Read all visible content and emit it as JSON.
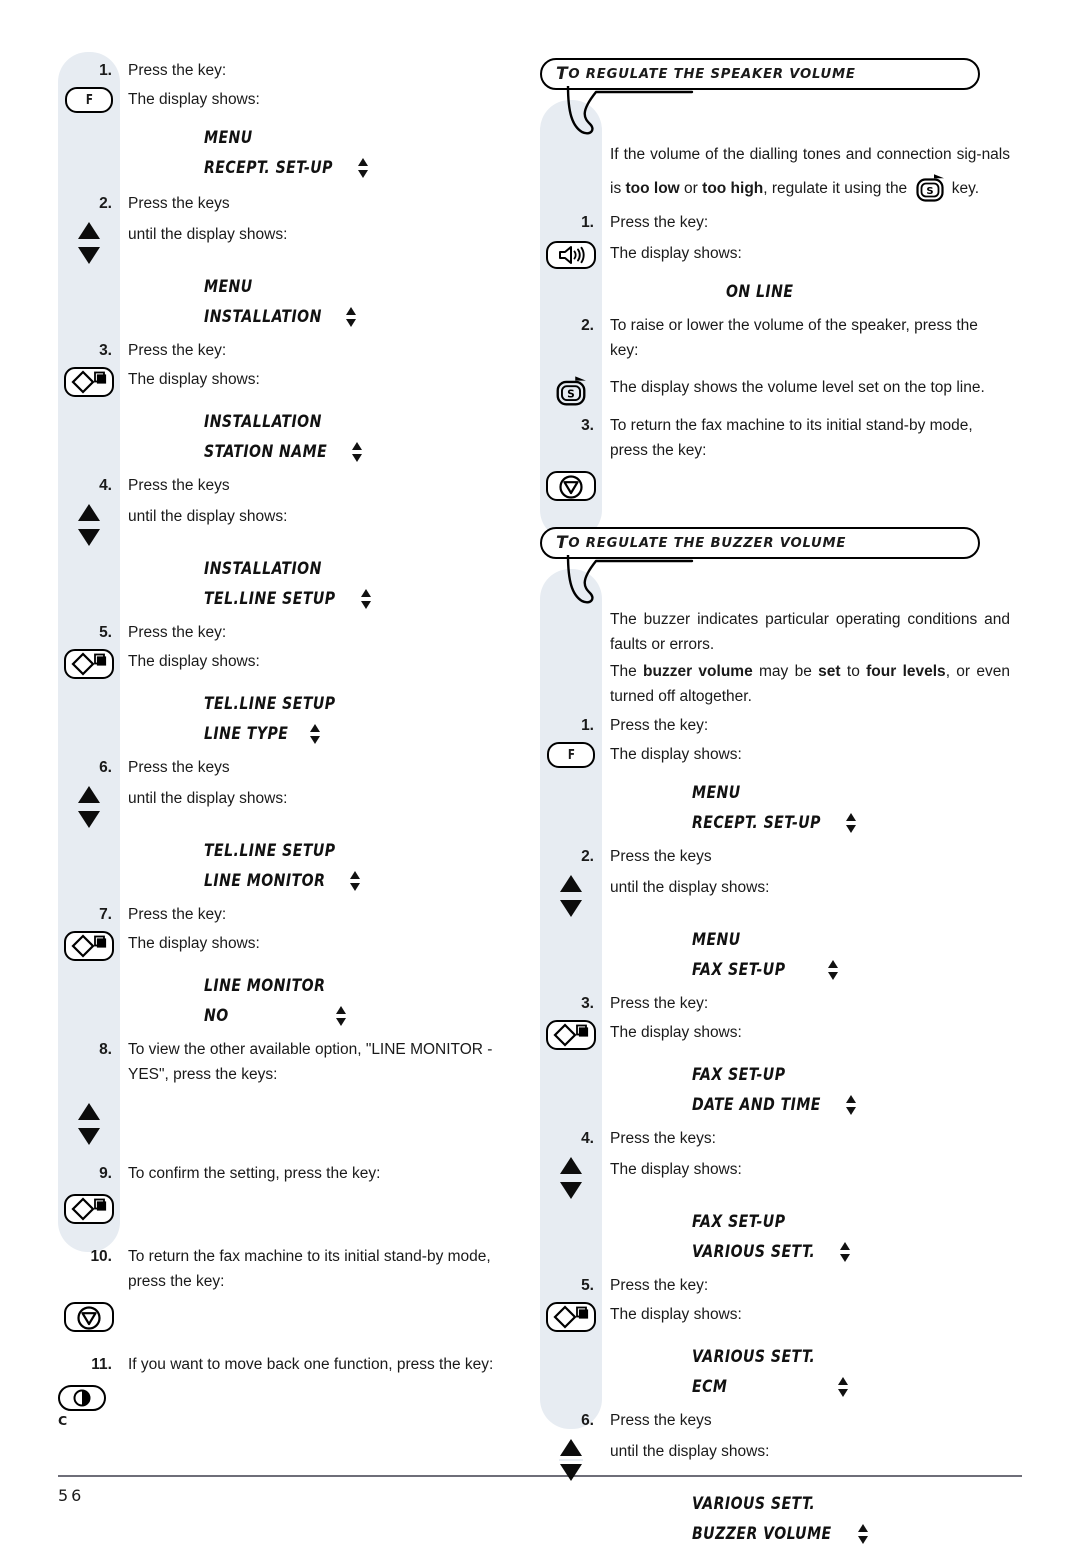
{
  "page": {
    "number": "56"
  },
  "left_column": {
    "steps": [
      {
        "n": "1.",
        "text": "Press the key:"
      },
      {
        "n": "",
        "text": "The display shows:",
        "key": "F"
      },
      {
        "lcd": "MENU"
      },
      {
        "lcd": "RECEPT. SET-UP",
        "arrow": true
      },
      {
        "n": "2.",
        "text": "Press the keys"
      },
      {
        "n": "",
        "text": "until the display shows:",
        "key": "updown"
      },
      {
        "lcd": "MENU"
      },
      {
        "lcd": "INSTALLATION",
        "arrow": true
      },
      {
        "n": "3.",
        "text": "Press the key:"
      },
      {
        "n": "",
        "text": "The display shows:",
        "key": "enter"
      },
      {
        "lcd": "INSTALLATION"
      },
      {
        "lcd": "STATION NAME",
        "arrow": true
      },
      {
        "n": "4.",
        "text": "Press the keys"
      },
      {
        "n": "",
        "text": "until the display shows:",
        "key": "updown"
      },
      {
        "lcd": "INSTALLATION"
      },
      {
        "lcd": "TEL.LINE SETUP",
        "arrow": true
      },
      {
        "n": "5.",
        "text": "Press the key:"
      },
      {
        "n": "",
        "text": "The display shows:",
        "key": "enter"
      },
      {
        "lcd": "TEL.LINE SETUP"
      },
      {
        "lcd": "LINE TYPE",
        "arrow": true
      },
      {
        "n": "6.",
        "text": "Press the keys"
      },
      {
        "n": "",
        "text": "until the display shows:",
        "key": "updown"
      },
      {
        "lcd": "TEL.LINE SETUP"
      },
      {
        "lcd": "LINE MONITOR",
        "arrow": true
      },
      {
        "n": "7.",
        "text": "Press the key:"
      },
      {
        "n": "",
        "text": "The display shows:",
        "key": "enter"
      },
      {
        "lcd": "LINE MONITOR"
      },
      {
        "lcd": "NO",
        "arrow": true
      },
      {
        "n": "8.",
        "text": "To view the other available option, \"LINE MONITOR - YES\", press the keys:"
      },
      {
        "n": "",
        "text": "",
        "key": "updown"
      },
      {
        "n": "9.",
        "text": "To confirm the setting, press the key:"
      },
      {
        "n": "",
        "text": "",
        "key": "enter"
      },
      {
        "n": "10.",
        "text": "To return the fax machine to its initial stand-by mode, press the key:"
      },
      {
        "n": "",
        "text": "",
        "key": "stop"
      },
      {
        "n": "11.",
        "text": "If you want to move back one function, press the key:"
      },
      {
        "n": "",
        "text": "",
        "key": "c",
        "caption": "C"
      }
    ]
  },
  "right_column": {
    "sections": [
      {
        "title_cap": "T",
        "title_rest": "O REGULATE THE SPEAKER VOLUME",
        "intro": [
          "If the volume of the dialling tones and connection sig-",
          "nals is ",
          "too low",
          " or ",
          "too high",
          ", regulate it using the ",
          " key."
        ],
        "steps": [
          {
            "n": "1.",
            "text": "Press the key:"
          },
          {
            "n": "",
            "text": "The display shows:",
            "key": "speaker"
          },
          {
            "lcd": "ON LINE",
            "center": true
          },
          {
            "n": "2.",
            "text": "To raise or lower the volume of the speaker, press the key:"
          },
          {
            "n": "",
            "text": "The display shows the volume level set on the top line.",
            "key": "skey"
          },
          {
            "n": "3.",
            "text": "To return the fax machine to its initial stand-by mode, press the key:"
          },
          {
            "n": "",
            "text": "",
            "key": "stop"
          }
        ]
      },
      {
        "title_cap": "T",
        "title_rest": "O REGULATE THE BUZZER VOLUME",
        "intro_1": "The buzzer indicates particular operating conditions and faults or errors.",
        "intro_2_parts": [
          "The ",
          "buzzer volume",
          " may be ",
          "set",
          " to ",
          "four levels",
          ", or even turned off altogether."
        ],
        "steps": [
          {
            "n": "1.",
            "text": "Press the key:"
          },
          {
            "n": "",
            "text": "The display shows:",
            "key": "F"
          },
          {
            "lcd": "MENU"
          },
          {
            "lcd": "RECEPT. SET-UP",
            "arrow": true
          },
          {
            "n": "2.",
            "text": "Press the keys"
          },
          {
            "n": "",
            "text": "until the display shows:",
            "key": "updown"
          },
          {
            "lcd": "MENU"
          },
          {
            "lcd": "FAX SET-UP",
            "arrow": true
          },
          {
            "n": "3.",
            "text": "Press the key:"
          },
          {
            "n": "",
            "text": "The display shows:",
            "key": "enter"
          },
          {
            "lcd": "FAX SET-UP"
          },
          {
            "lcd": "DATE AND TIME",
            "arrow": true
          },
          {
            "n": "4.",
            "text": "Press the keys:"
          },
          {
            "n": "",
            "text": "The display shows:",
            "key": "updown"
          },
          {
            "lcd": "FAX SET-UP"
          },
          {
            "lcd": "VARIOUS SETT.",
            "arrow": true
          },
          {
            "n": "5.",
            "text": "Press the key:"
          },
          {
            "n": "",
            "text": "The display shows:",
            "key": "enter"
          },
          {
            "lcd": "VARIOUS SETT."
          },
          {
            "lcd": "ECM",
            "arrow": true
          },
          {
            "n": "6.",
            "text": "Press the keys"
          },
          {
            "n": "",
            "text": "until the display shows:",
            "key": "updown"
          },
          {
            "lcd": "VARIOUS SETT."
          },
          {
            "lcd": "BUZZER VOLUME",
            "arrow": true
          }
        ]
      }
    ]
  },
  "icons": {
    "f_key": "function-key",
    "enter_key": "start-copy-key",
    "stop_key": "stop-key",
    "c_key": "clear-key",
    "updown_key": "up-down-arrow-keys",
    "speaker_key": "speaker-key",
    "s_key": "volume-s-key",
    "lcd_arrow": "up-down-indicator"
  },
  "colors": {
    "band": "#e7ecf2",
    "ink": "#1a1a1a",
    "rule": "#6e6e78"
  }
}
